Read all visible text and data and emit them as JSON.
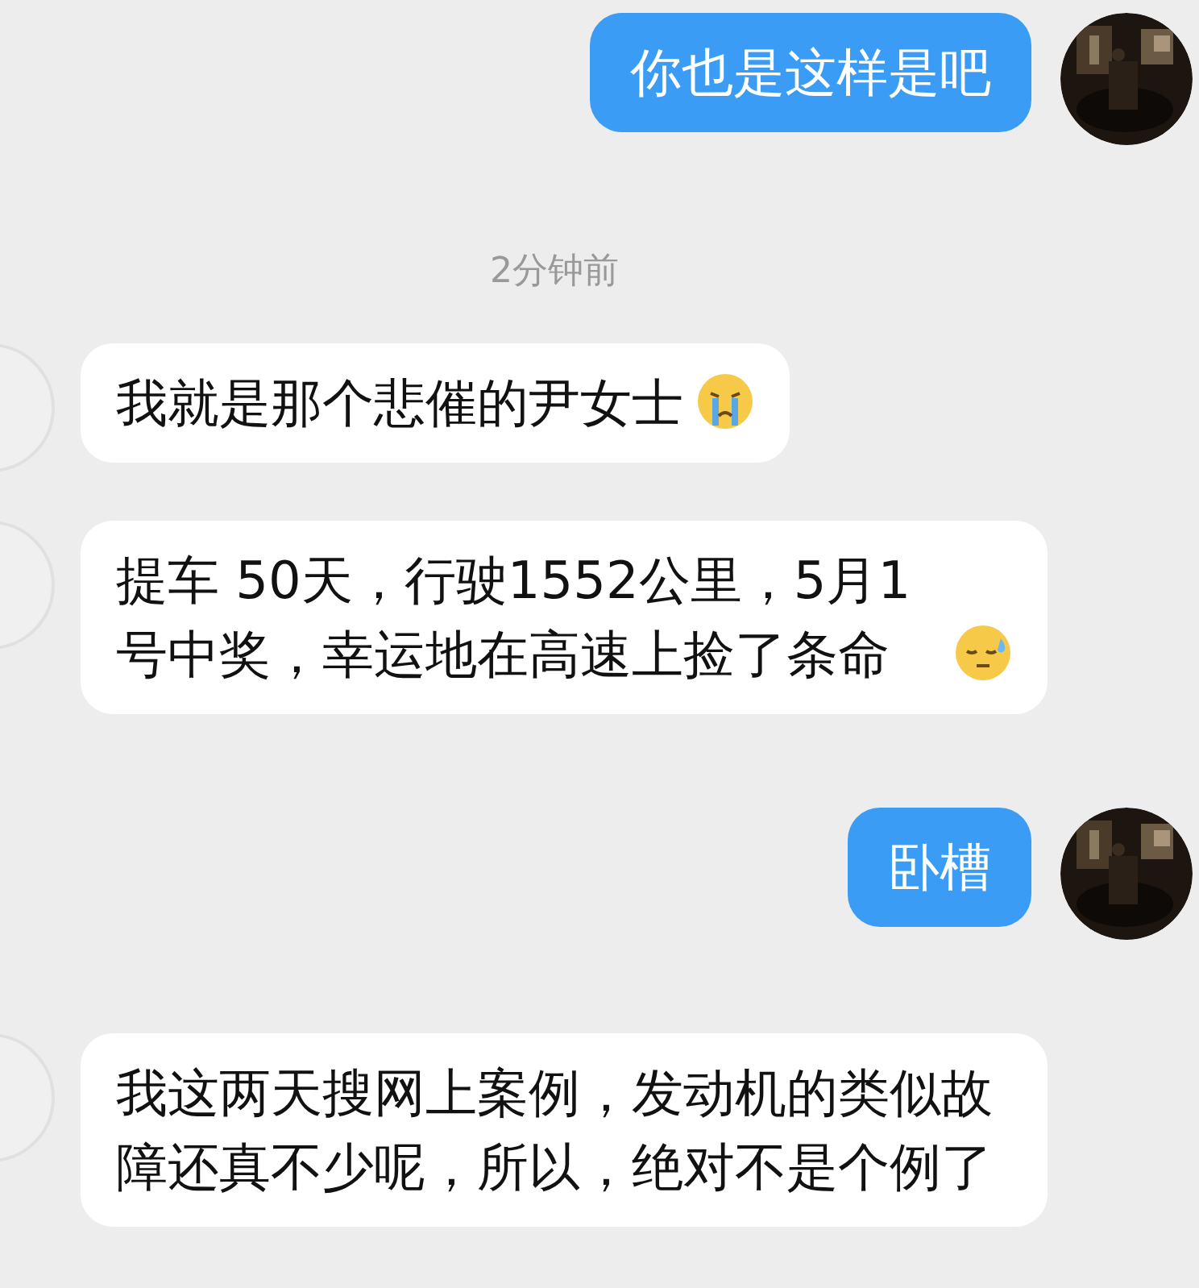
{
  "messages": [
    {
      "kind": "outgoing",
      "parts": [
        {
          "kind": "text",
          "text": "你也是这样是吧"
        }
      ]
    },
    {
      "kind": "time",
      "text": "2分钟前"
    },
    {
      "kind": "incoming",
      "parts": [
        {
          "kind": "text",
          "text": "我就是那个悲催的尹女士"
        },
        {
          "kind": "crying-emoji"
        }
      ]
    },
    {
      "kind": "incoming",
      "parts": [
        {
          "kind": "text",
          "text": "提车 50天，行驶1552公里，5月1号中奖，幸运地在高速上捡了条命"
        },
        {
          "kind": "sweat-emoji"
        }
      ]
    },
    {
      "kind": "outgoing",
      "parts": [
        {
          "kind": "text",
          "text": "卧槽"
        }
      ]
    },
    {
      "kind": "incoming",
      "parts": [
        {
          "kind": "text",
          "text": "我这两天搜网上案例，发动机的类似故障还真不少呢，所以，绝对不是个例了"
        }
      ]
    }
  ]
}
